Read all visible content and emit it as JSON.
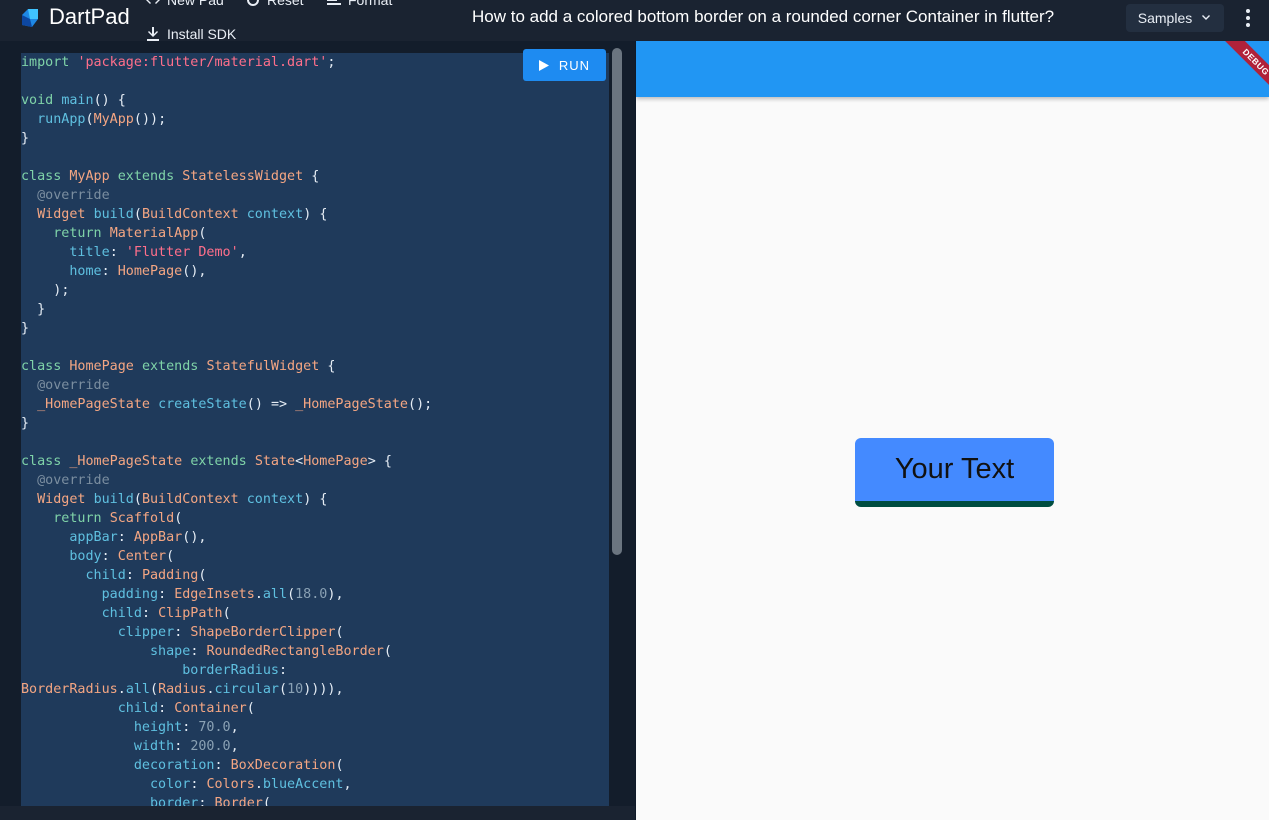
{
  "app": {
    "brand": "DartPad"
  },
  "toolbar": {
    "new_pad": "New Pad",
    "reset": "Reset",
    "format": "Format",
    "install_sdk": "Install SDK"
  },
  "title": "How to add a colored bottom border on a rounded corner Container in flutter?",
  "samples": {
    "label": "Samples"
  },
  "editor": {
    "run_label": "RUN",
    "lines": [
      "import 'package:flutter/material.dart';",
      "",
      "void main() {",
      "  runApp(MyApp());",
      "}",
      "",
      "class MyApp extends StatelessWidget {",
      "  @override",
      "  Widget build(BuildContext context) {",
      "    return MaterialApp(",
      "      title: 'Flutter Demo',",
      "      home: HomePage(),",
      "    );",
      "  }",
      "}",
      "",
      "class HomePage extends StatefulWidget {",
      "  @override",
      "  _HomePageState createState() => _HomePageState();",
      "}",
      "",
      "class _HomePageState extends State<HomePage> {",
      "  @override",
      "  Widget build(BuildContext context) {",
      "    return Scaffold(",
      "      appBar: AppBar(),",
      "      body: Center(",
      "        child: Padding(",
      "          padding: EdgeInsets.all(18.0),",
      "          child: ClipPath(",
      "            clipper: ShapeBorderClipper(",
      "                shape: RoundedRectangleBorder(",
      "                    borderRadius:",
      "BorderRadius.all(Radius.circular(10)))),",
      "            child: Container(",
      "              height: 70.0,",
      "              width: 200.0,",
      "              decoration: BoxDecoration(",
      "                color: Colors.blueAccent,",
      "                border: Border("
    ]
  },
  "preview": {
    "debug_label": "DEBUG",
    "box_text": "Your Text",
    "box_color": "#448aff",
    "border_color": "#004d40",
    "appbar_color": "#2196f3"
  }
}
